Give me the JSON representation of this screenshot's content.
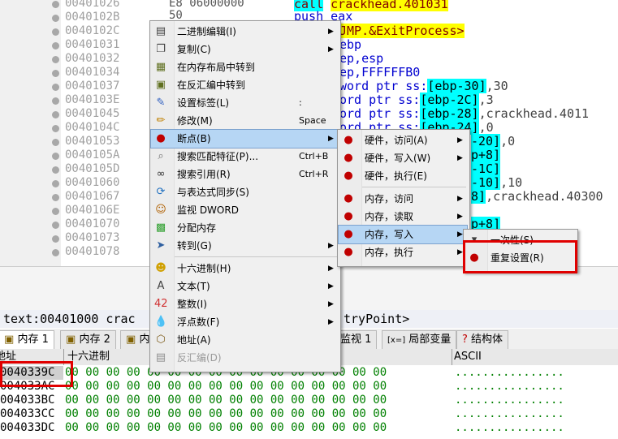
{
  "disasm": {
    "addresses": [
      "00401026",
      "0040102B",
      "0040102C",
      "00401031",
      "00401032",
      "00401034",
      "00401037",
      "0040103E",
      "00401045",
      "0040104C",
      "00401053",
      "0040105A",
      "0040105D",
      "00401060",
      "00401067",
      "0040106E",
      "00401070",
      "00401073",
      "00401078"
    ],
    "hex": [
      "E8 06000000",
      "50"
    ],
    "lines": [
      {
        "a": "call",
        "b": "crackhead.401031"
      },
      {
        "a": "push",
        "b": "eax"
      },
      {
        "a": "JMP.&ExitProcess>"
      },
      {
        "a": "ebp"
      },
      {
        "a": "ep,esp"
      },
      {
        "a": "ep,FFFFFFB0"
      },
      {
        "a": "word ptr ss:",
        "b": "[ebp-30]",
        ",": ",30"
      },
      {
        "a": "ord ptr ss:",
        "b": "[ebp-2C]",
        ",": ",3"
      },
      {
        "a": "ord ptr ss:",
        "b": "[ebp-28]",
        ",": ",crackhead.4011"
      },
      {
        "a": "ord ptr ss:",
        "b": "[ebp-24]",
        ",": ",0"
      },
      {
        "a": "",
        "b": "-20]",
        ",": ",0"
      },
      {
        "a": "",
        "b": "p+8]"
      },
      {
        "a": "",
        "b": "-1C]"
      },
      {
        "a": "",
        "b": "-10]",
        ",": ",10"
      },
      {
        "a": "",
        "b": "8]",
        ",": ",crackhead.40300"
      },
      {
        "a": "",
        "b": ""
      },
      {
        "a": "",
        "b": "p+8]"
      }
    ]
  },
  "status": {
    "left": "text:00401000 crac",
    "right": "tryPoint>"
  },
  "tabs": [
    {
      "label": "内存 1"
    },
    {
      "label": "内存 2"
    },
    {
      "label": "内"
    },
    {
      "label": "监视 1"
    },
    {
      "label": "局部变量"
    },
    {
      "label": "结构体"
    }
  ],
  "tab_prefixes": {
    "locals": "[x=]",
    "struct": "?"
  },
  "dump": {
    "headers": {
      "addr": "地址",
      "hex": "十六进制",
      "ascii": "ASCII"
    },
    "rows": [
      {
        "addr": "0040339C",
        "hex": "00 00 00 00 00 00 00 00 00 00 00 00 00 00 00 00",
        "ascii": "................"
      },
      {
        "addr": "004033AC",
        "hex": "00 00 00 00 00 00 00 00 00 00 00 00 00 00 00 00",
        "ascii": "................"
      },
      {
        "addr": "004033BC",
        "hex": "00 00 00 00 00 00 00 00 00 00 00 00 00 00 00 00",
        "ascii": "................"
      },
      {
        "addr": "004033CC",
        "hex": "00 00 00 00 00 00 00 00 00 00 00 00 00 00 00 00",
        "ascii": "................"
      },
      {
        "addr": "004033DC",
        "hex": "00 00 00 00 00 00 00 00 00 00 00 00 00 00 00 00",
        "ascii": "................"
      }
    ]
  },
  "menu1": [
    {
      "label": "二进制编辑(I)",
      "icon": "binary-edit-icon",
      "glyph": "▤",
      "arrow": true
    },
    {
      "label": "复制(C)",
      "icon": "copy-icon",
      "glyph": "❐",
      "arrow": true
    },
    {
      "label": "在内存布局中转到",
      "icon": "memory-map-icon",
      "glyph": "▦"
    },
    {
      "label": "在反汇编中转到",
      "icon": "disassembly-icon",
      "glyph": "▣"
    },
    {
      "label": "设置标签(L)",
      "icon": "tag-icon",
      "glyph": "✎",
      "shortcut": ":"
    },
    {
      "label": "修改(M)",
      "icon": "pencil-icon",
      "glyph": "✏",
      "shortcut": "Space"
    },
    {
      "label": "断点(B)",
      "icon": "breakpoint-icon",
      "glyph": "●",
      "arrow": true
    },
    {
      "label": "搜索匹配特征(P)...",
      "icon": "search-pattern-icon",
      "glyph": "⌕",
      "shortcut": "Ctrl+B"
    },
    {
      "label": "搜索引用(R)",
      "icon": "binoculars-icon",
      "glyph": "∞",
      "shortcut": "Ctrl+R"
    },
    {
      "label": "与表达式同步(S)",
      "icon": "sync-icon",
      "glyph": "⟳"
    },
    {
      "label": "监视 DWORD",
      "icon": "watch-icon",
      "glyph": "☺"
    },
    {
      "label": "分配内存",
      "icon": "allocate-memory-icon",
      "glyph": "▩"
    },
    {
      "label": "转到(G)",
      "icon": "goto-icon",
      "glyph": "➤",
      "arrow": true
    },
    {
      "label": "十六进制(H)",
      "icon": "hex-icon",
      "glyph": "☻",
      "arrow": true
    },
    {
      "label": "文本(T)",
      "icon": "text-icon",
      "glyph": "A",
      "arrow": true
    },
    {
      "label": "整数(I)",
      "icon": "integer-icon",
      "glyph": "42",
      "arrow": true
    },
    {
      "label": "浮点数(F)",
      "icon": "float-icon",
      "glyph": "💧",
      "arrow": true
    },
    {
      "label": "地址(A)",
      "icon": "address-icon",
      "glyph": "⬡"
    },
    {
      "label": "反汇编(D)",
      "icon": "disasm-view-icon",
      "glyph": "▤",
      "disabled": true
    }
  ],
  "menu2": [
    {
      "label": "硬件，访问(A)",
      "icon": "hw-access-icon",
      "glyph": "●",
      "arrow": true
    },
    {
      "label": "硬件，写入(W)",
      "icon": "hw-write-icon",
      "glyph": "●",
      "arrow": true
    },
    {
      "label": "硬件，执行(E)",
      "icon": "hw-exec-icon",
      "glyph": "●"
    },
    {
      "label": "内存，访问",
      "icon": "mem-access-icon",
      "glyph": "●",
      "arrow": true
    },
    {
      "label": "内存，读取",
      "icon": "mem-read-icon",
      "glyph": "●",
      "arrow": true
    },
    {
      "label": "内存，写入",
      "icon": "mem-write-icon",
      "glyph": "●",
      "arrow": true
    },
    {
      "label": "内存，执行",
      "icon": "mem-exec-icon",
      "glyph": "●",
      "arrow": true
    }
  ],
  "menu3": [
    {
      "label": "一次性(S)",
      "icon": "once-icon",
      "glyph": "▾"
    },
    {
      "label": "重复设置(R)",
      "icon": "repeat-icon",
      "glyph": "●"
    }
  ],
  "colors": {
    "highlight_box": "#e00000",
    "menu_selected": "#b6d6f4"
  }
}
